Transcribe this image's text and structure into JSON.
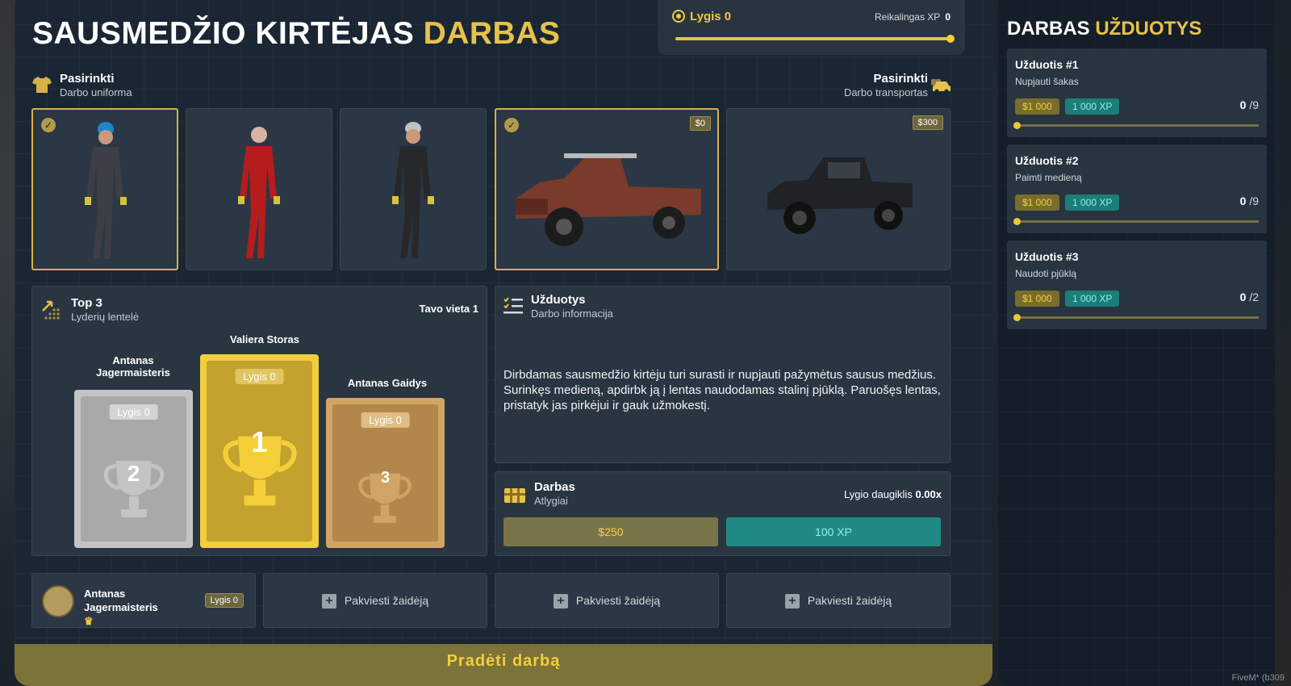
{
  "header": {
    "title_main": "SAUSMEDŽIO KIRTĖJAS",
    "title_accent": "DARBAS",
    "level_label": "Lygis 0",
    "required_xp_label": "Reikalingas XP",
    "required_xp_value": "0",
    "xp_progress": 1.0
  },
  "uniform": {
    "heading": "Pasirinkti",
    "sub": "Darbo uniforma",
    "options": [
      {
        "name": "uniform-grey",
        "selected": true
      },
      {
        "name": "uniform-red",
        "selected": false
      },
      {
        "name": "uniform-black",
        "selected": false
      }
    ]
  },
  "transport": {
    "heading": "Pasirinkti",
    "sub": "Darbo transportas",
    "options": [
      {
        "price": "$0",
        "selected": true
      },
      {
        "price": "$300",
        "selected": false
      }
    ]
  },
  "leaderboard": {
    "heading": "Top 3",
    "sub": "Lyderių lentelė",
    "your_place_label": "Tavo vieta",
    "your_place_value": "1",
    "first": {
      "name": "Valiera Storas",
      "level": "Lygis 0",
      "rank": "1"
    },
    "second": {
      "name": "Antanas Jagermaisteris",
      "level": "Lygis 0",
      "rank": "2"
    },
    "third": {
      "name": "Antanas Gaidys",
      "level": "Lygis 0",
      "rank": "3"
    }
  },
  "tasks_info": {
    "heading": "Užduotys",
    "sub": "Darbo informacija",
    "description": "Dirbdamas sausmedžio kirtėju turi surasti ir nupjauti pažymėtus sausus medžius. Surinkęs medieną, apdirbk ją į lentas naudodamas stalinį pjūklą. Paruošęs lentas, pristatyk jas pirkėjui ir gauk užmokestį."
  },
  "rewards": {
    "heading": "Darbas",
    "sub": "Atlygiai",
    "multiplier_label": "Lygio daugiklis",
    "multiplier_value": "0.00x",
    "money": "$250",
    "xp": "100 XP"
  },
  "party": {
    "member_name": "Antanas Jagermaisteris",
    "member_level": "Lygis 0",
    "invite_label": "Pakviesti žaidėją"
  },
  "start_button": "Pradėti darbą",
  "sidebar": {
    "title_main": "DARBAS",
    "title_accent": "UŽDUOTYS",
    "tasks": [
      {
        "name": "Užduotis #1",
        "desc": "Nupjauti šakas",
        "money": "$1 000",
        "xp": "1 000 XP",
        "done": "0",
        "total": "/9"
      },
      {
        "name": "Užduotis #2",
        "desc": "Paimti medieną",
        "money": "$1 000",
        "xp": "1 000 XP",
        "done": "0",
        "total": "/9"
      },
      {
        "name": "Užduotis #3",
        "desc": "Naudoti pjūklą",
        "money": "$1 000",
        "xp": "1 000 XP",
        "done": "0",
        "total": "/2"
      }
    ]
  },
  "watermark": "FiveM* (b309",
  "colors": {
    "accent": "#e7c24a",
    "teal": "#1f8a83",
    "panel": "#2a3542"
  }
}
